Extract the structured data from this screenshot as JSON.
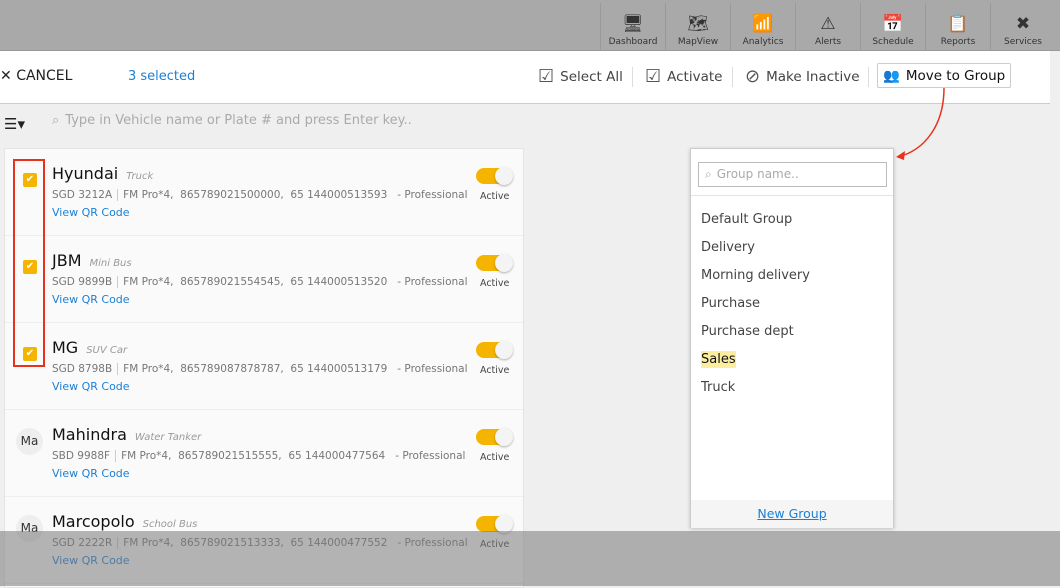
{
  "nav": [
    {
      "label": "Dashboard",
      "icon": "dashboard-icon"
    },
    {
      "label": "MapView",
      "icon": "map-icon"
    },
    {
      "label": "Analytics",
      "icon": "analytics-icon"
    },
    {
      "label": "Alerts",
      "icon": "alert-icon"
    },
    {
      "label": "Schedule",
      "icon": "calendar-icon"
    },
    {
      "label": "Reports",
      "icon": "report-icon"
    },
    {
      "label": "Services",
      "icon": "tools-icon"
    }
  ],
  "actions": {
    "cancel": "CANCEL",
    "selected": "3 selected",
    "select_all": "Select All",
    "activate": "Activate",
    "make_inactive": "Make Inactive",
    "move_to_group": "Move to Group"
  },
  "search": {
    "placeholder": "Type in Vehicle name or Plate # and press Enter key.."
  },
  "vehicles": [
    {
      "name": "Hyundai",
      "type": "Truck",
      "plate": "SGD 3212A",
      "details": "FM Pro*4,  865789021500000,  65 144000513593   - Professional",
      "qr": "View QR Code",
      "status": "Active",
      "checked": true
    },
    {
      "name": "JBM",
      "type": "Mini Bus",
      "plate": "SGD 9899B",
      "details": "FM Pro*4,  865789021554545,  65 144000513520   - Professional",
      "qr": "View QR Code",
      "status": "Active",
      "checked": true
    },
    {
      "name": "MG",
      "type": "SUV Car",
      "plate": "SGD 8798B",
      "details": "FM Pro*4,  865789087878787,  65 144000513179   - Professional",
      "qr": "View QR Code",
      "status": "Active",
      "checked": true
    },
    {
      "name": "Mahindra",
      "type": "Water Tanker",
      "avatar": "Ma",
      "plate": "SBD 9988F",
      "details": "FM Pro*4,  865789021515555,  65 144000477564   - Professional",
      "qr": "View QR Code",
      "status": "Active",
      "checked": false
    },
    {
      "name": "Marcopolo",
      "type": "School Bus",
      "avatar": "Ma",
      "plate": "SGD 2222R",
      "details": "FM Pro*4,  865789021513333,  65 144000477552   - Professional",
      "qr": "View QR Code",
      "status": "Active",
      "checked": false
    }
  ],
  "group_popup": {
    "placeholder": "Group name..",
    "groups": [
      "Default Group",
      "Delivery",
      "Morning delivery",
      "Purchase",
      "Purchase dept",
      "Sales",
      "Truck"
    ],
    "highlighted": "Sales",
    "new_group": "New Group"
  },
  "colors": {
    "accent": "#f5b400",
    "link": "#1a7fd6",
    "annotation": "#e8321e"
  }
}
